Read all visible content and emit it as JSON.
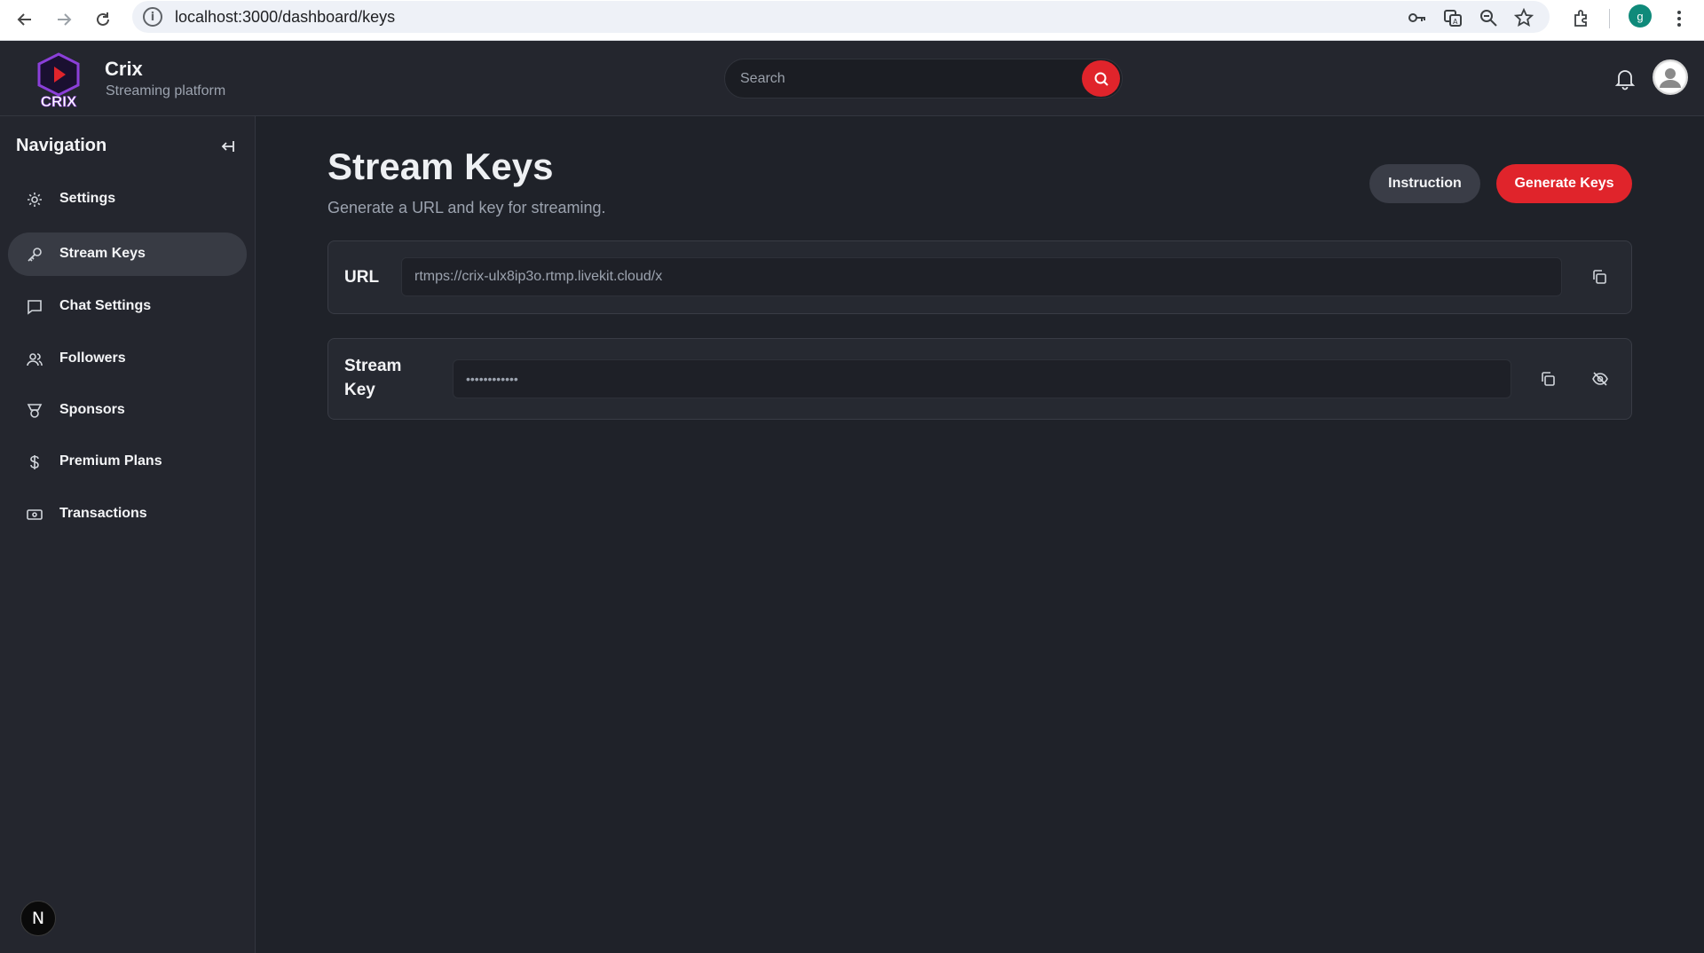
{
  "browser": {
    "url": "localhost:3000/dashboard/keys",
    "profile_initial": "g"
  },
  "header": {
    "logo_text": "CRIX",
    "brand_title": "Crix",
    "brand_subtitle": "Streaming platform",
    "search_placeholder": "Search"
  },
  "sidebar": {
    "title": "Navigation",
    "items": [
      {
        "label": "Settings",
        "icon": "gear-icon"
      },
      {
        "label": "Stream Keys",
        "icon": "key-icon",
        "active": true
      },
      {
        "label": "Chat Settings",
        "icon": "chat-icon"
      },
      {
        "label": "Followers",
        "icon": "users-icon"
      },
      {
        "label": "Sponsors",
        "icon": "badge-icon"
      },
      {
        "label": "Premium Plans",
        "icon": "dollar-icon"
      },
      {
        "label": "Transactions",
        "icon": "cash-icon"
      }
    ],
    "bottom_badge": "N"
  },
  "main": {
    "title": "Stream Keys",
    "subtitle": "Generate a URL and key for streaming.",
    "instruction_label": "Instruction",
    "generate_label": "Generate Keys",
    "url_label": "URL",
    "url_value": "rtmps://crix-ulx8ip3o.rtmp.livekit.cloud/x",
    "key_label_line1": "Stream",
    "key_label_line2": "Key",
    "key_value": "••••••••••••"
  },
  "colors": {
    "accent": "#e0242b",
    "background": "#1f2229",
    "panel": "#24262e",
    "logo_purple": "#8b3fd9"
  }
}
